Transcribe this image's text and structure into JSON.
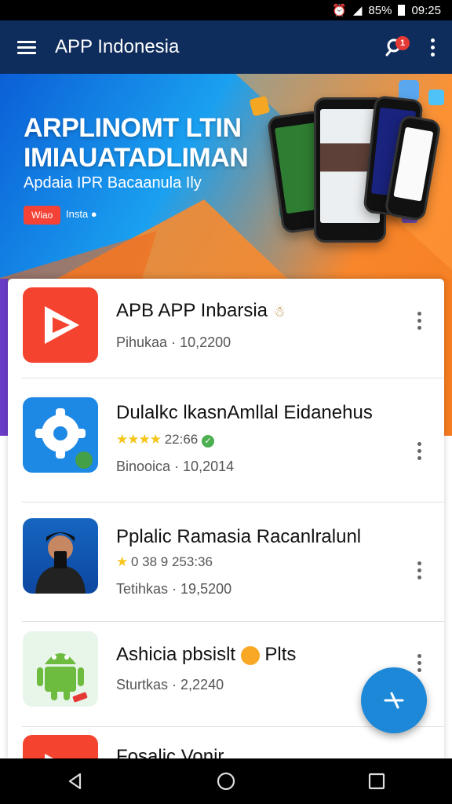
{
  "status_bar": {
    "signal": "◢",
    "battery_pct": "85%",
    "time": "09:25"
  },
  "app_bar": {
    "title": "APP Indonesia",
    "notification_count": "1"
  },
  "banner": {
    "title_line1": "ARPLINOMT LTIN",
    "title_line2": "IMIAUATADLIMAN",
    "subtitle": "Apdaia IPR Bacaanula Ily",
    "chip_label": "Wiao",
    "chip_text": "Insta ●"
  },
  "apps": [
    {
      "name": "APB APP Inbarsia",
      "badge": "☃",
      "rating_stars": "",
      "rating_text": "",
      "meta_label": "Pihukaa",
      "meta_value": "10,2200",
      "icon": "play-store-icon"
    },
    {
      "name": "Dulalkc lkasnAmllal Eidanehus",
      "badge": "",
      "rating_stars": "★★★★",
      "rating_text": "22:66",
      "meta_label": "Binooica",
      "meta_value": "10,2014",
      "icon": "gear-icon"
    },
    {
      "name": "Pplalic Ramasia Racanlralunl",
      "badge": "",
      "rating_stars": "★",
      "rating_text": "0 38 9 253:36",
      "meta_label": "Tetihkas",
      "meta_value": "19,5200",
      "icon": "person-photo-icon"
    },
    {
      "name": "Ashicia pbsislt",
      "badge": "Plts",
      "rating_stars": "",
      "rating_text": "",
      "meta_label": "Sturtkas",
      "meta_value": "2,2240",
      "icon": "android-icon"
    },
    {
      "name": "Fosalic Vonir",
      "badge": "",
      "rating_stars": "",
      "rating_text": "",
      "meta_label": "",
      "meta_value": "",
      "icon": "play-store-icon"
    }
  ],
  "colors": {
    "app_bar": "#0e2c5c",
    "fab": "#1e88d8",
    "star": "#f5c518"
  }
}
